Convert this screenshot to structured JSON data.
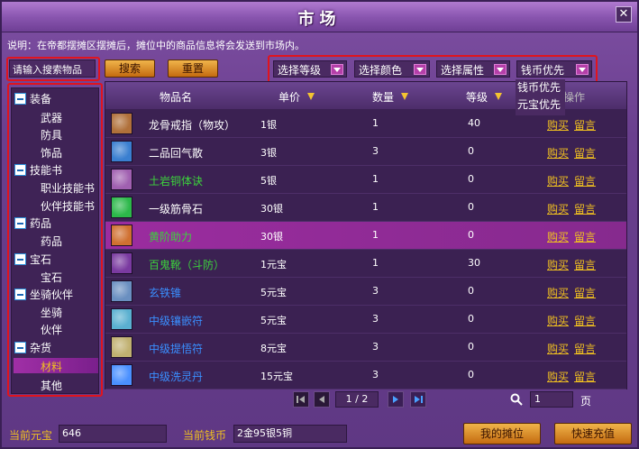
{
  "window": {
    "title": "市场",
    "close": "✕"
  },
  "description": "说明：在帝都摆摊区摆摊后，摊位中的商品信息将会发送到市场内。",
  "search": {
    "placeholder": "请输入搜索物品",
    "search_label": "搜索",
    "reset_label": "重置"
  },
  "filters": [
    {
      "label": "选择等级"
    },
    {
      "label": "选择颜色"
    },
    {
      "label": "选择属性"
    },
    {
      "label": "钱币优先"
    }
  ],
  "sort_dropdown_options": [
    "钱币优先",
    "元宝优先"
  ],
  "sidebar": [
    {
      "category": "装备",
      "items": [
        "武器",
        "防具",
        "饰品"
      ]
    },
    {
      "category": "技能书",
      "items": [
        "职业技能书",
        "伙伴技能书"
      ]
    },
    {
      "category": "药品",
      "items": [
        "药品"
      ]
    },
    {
      "category": "宝石",
      "items": [
        "宝石"
      ]
    },
    {
      "category": "坐骑伙伴",
      "items": [
        "坐骑",
        "伙伴"
      ]
    },
    {
      "category": "杂货",
      "items": [
        "材料",
        "其他"
      ]
    }
  ],
  "selected_sidebar_item": "材料",
  "table": {
    "headers": {
      "name": "物品名",
      "price": "单价",
      "qty": "数量",
      "level": "等级",
      "op": "操作"
    },
    "rows": [
      {
        "name": "龙骨戒指（物攻）",
        "color": "#ffffff",
        "price": "1银",
        "qty": "1",
        "level": "40",
        "icon_color": "#b0703a"
      },
      {
        "name": "二品回气散",
        "color": "#ffffff",
        "price": "3银",
        "qty": "3",
        "level": "0",
        "icon_color": "#3a7fd0"
      },
      {
        "name": "土岩铜体诀",
        "color": "#3cd23c",
        "price": "5银",
        "qty": "1",
        "level": "0",
        "icon_color": "#a060b0"
      },
      {
        "name": "一级筋骨石",
        "color": "#ffffff",
        "price": "30银",
        "qty": "1",
        "level": "0",
        "icon_color": "#2cb84a"
      },
      {
        "name": "黄阶助力",
        "color": "#3cd23c",
        "price": "30银",
        "qty": "1",
        "level": "0",
        "icon_color": "#d07030"
      },
      {
        "name": "百鬼靴（斗防）",
        "color": "#3cd23c",
        "price": "1元宝",
        "qty": "1",
        "level": "30",
        "icon_color": "#7a3aa0"
      },
      {
        "name": "玄铁锥",
        "color": "#3a8fff",
        "price": "5元宝",
        "qty": "3",
        "level": "0",
        "icon_color": "#6a8fc0"
      },
      {
        "name": "中级镶嵌符",
        "color": "#3a8fff",
        "price": "5元宝",
        "qty": "3",
        "level": "0",
        "icon_color": "#5ab0d0"
      },
      {
        "name": "中级提悟符",
        "color": "#3a8fff",
        "price": "8元宝",
        "qty": "3",
        "level": "0",
        "icon_color": "#c0b070"
      },
      {
        "name": "中级洗灵丹",
        "color": "#3a8fff",
        "price": "15元宝",
        "qty": "3",
        "level": "0",
        "icon_color": "#4a90ff"
      }
    ],
    "buy_label": "购买",
    "msg_label": "留言",
    "active_row_index": 4
  },
  "pager": {
    "indicator": "1 / 2",
    "goto_value": "1",
    "page_suffix": "页"
  },
  "bottom": {
    "yuanbao_label": "当前元宝",
    "yuanbao_value": "646",
    "money_label": "当前钱币",
    "money_value": "2金95银5铜",
    "my_stall_label": "我的摊位",
    "recharge_label": "快速充值"
  },
  "colors": {
    "highlight_box": "#e0141e",
    "accent_gold": "#f0c020",
    "active_row": "#9b2c9f"
  }
}
